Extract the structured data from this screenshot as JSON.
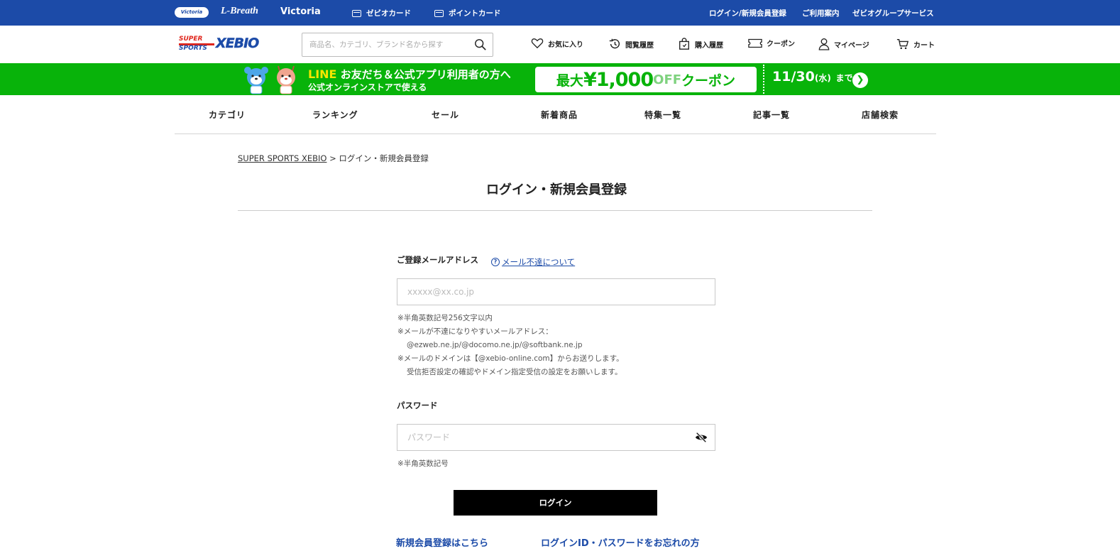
{
  "topbar": {
    "brand_victoria_golf": "Victoria Golf",
    "brand_lbreath": "L-Breath",
    "brand_victoria": "Victoria",
    "xebio_card": "ゼビオカード",
    "point_card": "ポイントカード",
    "login_register": "ログイン/新規会員登録",
    "guide": "ご利用案内",
    "group_services": "ゼビオグループサービス",
    "color": "#1c4ba8"
  },
  "header": {
    "logo_super": "SUPER",
    "logo_sports": "SPORTS",
    "logo_xebio": "XEBIO",
    "search_placeholder": "商品名、カテゴリ、ブランド名から探す",
    "nav": {
      "favorites": "お気に入り",
      "history": "閲覧履歴",
      "purchases": "購入履歴",
      "coupon": "クーポン",
      "mypage": "マイページ",
      "cart": "カート"
    }
  },
  "banner": {
    "line1_brand": "LINE",
    "line1_text": "お友だち＆公式アプリ利用者の方へ",
    "line2_text": "公式オンラインストアで使える",
    "coupon_prefix": "最大",
    "coupon_amount": "¥1,000",
    "coupon_off": "OFF",
    "coupon_suffix": "クーポン",
    "date": "11/30",
    "date_weekday": "(水)",
    "date_until": "まで",
    "color": "#08b30a"
  },
  "catnav": [
    "カテゴリ",
    "ランキング",
    "セール",
    "新着商品",
    "特集一覧",
    "記事一覧",
    "店舗検索"
  ],
  "breadcrumb": {
    "home": "SUPER SPORTS XEBIO",
    "separator": ">",
    "current": "ログイン・新規会員登録"
  },
  "page_title": "ログイン・新規会員登録",
  "form": {
    "email_label": "ご登録メールアドレス",
    "email_help": "メール不達について",
    "email_placeholder": "xxxxx@xx.co.jp",
    "email_notes": [
      "※半角英数記号256文字以内",
      "※メールが不達になりやすいメールアドレス：",
      "@ezweb.ne.jp/@docomo.ne.jp/@softbank.ne.jp",
      "※メールのドメインは【@xebio-online.com】からお送りします。",
      "受信拒否設定の確認やドメイン指定受信の設定をお願いします。"
    ],
    "password_label": "パスワード",
    "password_placeholder": "パスワード",
    "password_note": "※半角英数記号",
    "login_button": "ログイン"
  },
  "footer_links": {
    "register": "新規会員登録はこちら",
    "forgot": "ログインID・パスワードをお忘れの方"
  }
}
